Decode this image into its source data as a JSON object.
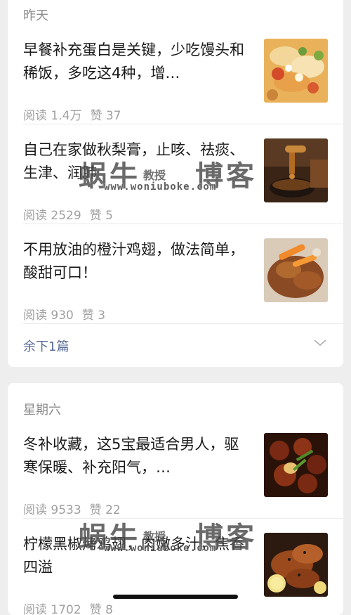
{
  "sections": [
    {
      "date": "昨天",
      "articles": [
        {
          "title": "早餐补充蛋白是关键，少吃馒头和稀饭，多吃这4种，增…",
          "reads": "阅读 1.4万",
          "likes": "赞 37",
          "thumb": "food-egg-salad-photo"
        },
        {
          "title": "自己在家做秋梨膏，止咳、祛痰、生津、润肺",
          "reads": "阅读 2529",
          "likes": "赞 5",
          "thumb": "honey-pear-syrup-photo"
        },
        {
          "title": "不用放油的橙汁鸡翅，做法简单，酸甜可口！",
          "reads": "阅读 930",
          "likes": "赞 3",
          "thumb": "orange-chicken-wings-photo"
        }
      ],
      "more": "余下1篇"
    },
    {
      "date": "星期六",
      "articles": [
        {
          "title": "冬补收藏，这5宝最适合男人，驱寒保暖、补充阳气，…",
          "reads": "阅读 9533",
          "likes": "赞 22",
          "thumb": "braised-meat-photo"
        },
        {
          "title": "柠檬黑椒烤鸡翅，肉嫩多汁，焦香四溢",
          "reads": "阅读 1702",
          "likes": "赞 8",
          "thumb": "lemon-pepper-wings-photo"
        }
      ]
    }
  ],
  "watermark": {
    "big_left": "蜗牛",
    "big_right": "博客",
    "mid": "教授",
    "url": "www.woniuboke.com"
  },
  "colors": {
    "link": "#576b95",
    "meta": "#a0a0a0",
    "title": "#1a1a1a",
    "background": "#eeeeee"
  }
}
